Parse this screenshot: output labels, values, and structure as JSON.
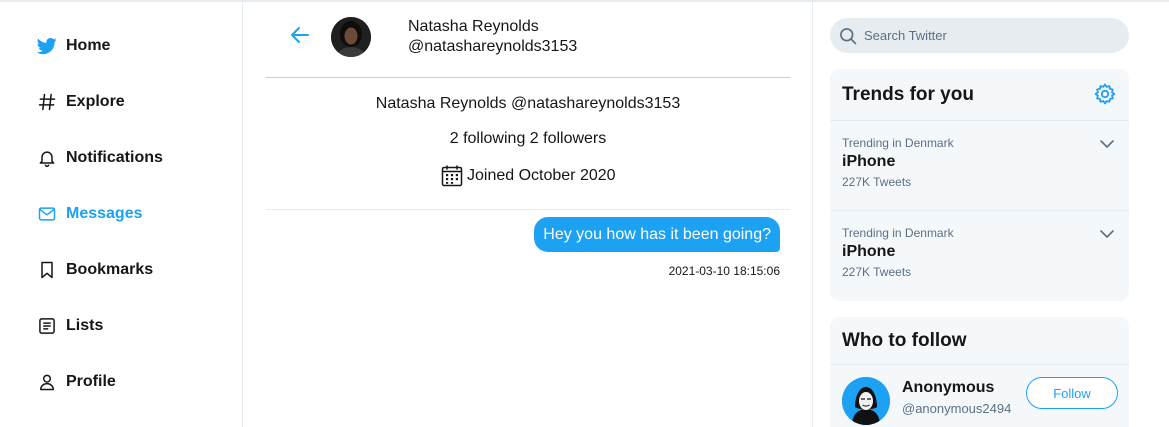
{
  "nav": {
    "items": [
      {
        "label": "Home",
        "icon": "twitter-bird-icon"
      },
      {
        "label": "Explore",
        "icon": "hashtag-icon"
      },
      {
        "label": "Notifications",
        "icon": "bell-icon"
      },
      {
        "label": "Messages",
        "icon": "envelope-icon",
        "active": true
      },
      {
        "label": "Bookmarks",
        "icon": "bookmark-icon"
      },
      {
        "label": "Lists",
        "icon": "list-icon"
      },
      {
        "label": "Profile",
        "icon": "person-icon"
      }
    ]
  },
  "conversation": {
    "header_name": "Natasha Reynolds",
    "header_handle": "@natashareynolds3153",
    "profile_line": "Natasha Reynolds @natashareynolds3153",
    "follow_stats": "2 following 2 followers",
    "joined": "Joined October 2020",
    "messages": [
      {
        "text": "Hey you how has it been going?",
        "timestamp": "2021-03-10 18:15:06"
      }
    ]
  },
  "search": {
    "placeholder": "Search Twitter"
  },
  "trends": {
    "title": "Trends for you",
    "items": [
      {
        "context": "Trending in Denmark",
        "name": "iPhone",
        "count": "227K Tweets"
      },
      {
        "context": "Trending in Denmark",
        "name": "iPhone",
        "count": "227K Tweets"
      }
    ]
  },
  "who_to_follow": {
    "title": "Who to follow",
    "users": [
      {
        "name": "Anonymous",
        "handle": "@anonymous2494",
        "button_label": "Follow"
      }
    ]
  },
  "colors": {
    "accent": "#1da1f2",
    "text": "#14171a",
    "muted": "#5b7083",
    "panel": "#f5f8fa",
    "border": "#e6ecf0"
  }
}
